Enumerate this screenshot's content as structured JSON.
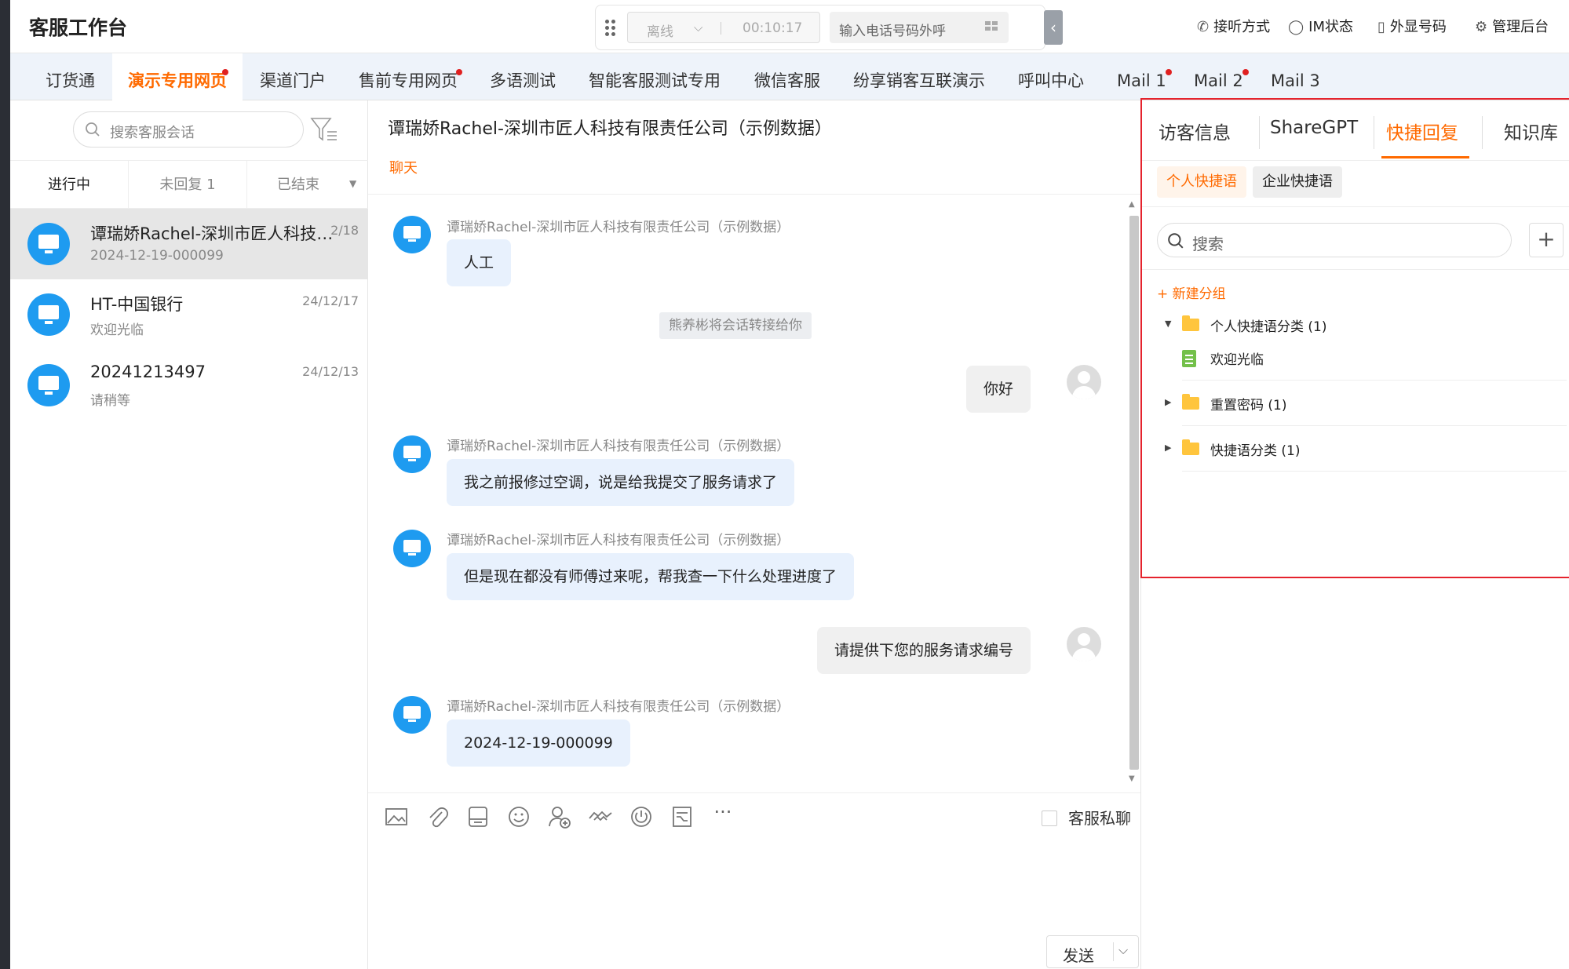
{
  "header": {
    "title": "客服工作台",
    "status": "离线",
    "timer": "00:10:17",
    "dial_placeholder": "输入电话号码外呼",
    "items": [
      {
        "icon": "phone-handset-icon",
        "label": "接听方式"
      },
      {
        "icon": "chat-bubble-icon",
        "label": "IM状态"
      },
      {
        "icon": "mobile-icon",
        "label": "外显号码"
      },
      {
        "icon": "gear-icon",
        "label": "管理后台"
      }
    ]
  },
  "tabs": [
    {
      "label": "订货通",
      "dot": false
    },
    {
      "label": "演示专用网页",
      "dot": true,
      "active": true
    },
    {
      "label": "渠道门户",
      "dot": false
    },
    {
      "label": "售前专用网页",
      "dot": true
    },
    {
      "label": "多语测试",
      "dot": false
    },
    {
      "label": "智能客服测试专用",
      "dot": false
    },
    {
      "label": "微信客服",
      "dot": false
    },
    {
      "label": "纷享销客互联演示",
      "dot": false
    },
    {
      "label": "呼叫中心",
      "dot": false
    },
    {
      "label": "Mail 1",
      "dot": true
    },
    {
      "label": "Mail 2",
      "dot": true
    },
    {
      "label": "Mail 3",
      "dot": false
    }
  ],
  "list": {
    "search_placeholder": "搜索客服会话",
    "subtabs": [
      "进行中",
      "未回复 1",
      "已结束"
    ],
    "conversations": [
      {
        "name": "谭瑞娇Rachel-深圳市匠人科技有限责任公司（示例数据）",
        "sub": "2024-12-19-000099",
        "date": "2/18"
      },
      {
        "name": "HT-中国银行",
        "sub": "欢迎光临",
        "date": "24/12/17"
      },
      {
        "name": "20241213497",
        "sub": "请稍等",
        "date": "24/12/13"
      }
    ]
  },
  "chat": {
    "title": "谭瑞娇Rachel-深圳市匠人科技有限责任公司（示例数据）",
    "subtab": "聊天",
    "sender": "谭瑞娇Rachel-深圳市匠人科技有限责任公司（示例数据）",
    "messages": {
      "m1": "人工",
      "sys": "熊养彬将会话转接给你",
      "m2": "你好",
      "m3": "我之前报修过空调，说是给我提交了服务请求了",
      "m4": "但是现在都没有师傅过来呢，帮我查一下什么处理进度了",
      "m5": "请提供下您的服务请求编号",
      "m6": "2024-12-19-000099"
    },
    "toolbar_icons": [
      "image-icon",
      "attachment-icon",
      "inbox-icon",
      "emoji-icon",
      "add-user-icon",
      "handshake-icon",
      "power-icon",
      "form-icon",
      "more-icon"
    ],
    "private_label": "客服私聊",
    "send_label": "发送"
  },
  "right": {
    "tabs": [
      "访客信息",
      "ShareGPT",
      "快捷回复",
      "知识库"
    ],
    "active_tab": "快捷回复",
    "chips": [
      "个人快捷语",
      "企业快捷语"
    ],
    "search_placeholder": "搜索",
    "new_group": "+ 新建分组",
    "groups": [
      {
        "label": "个人快捷语分类 (1)",
        "expanded": true,
        "items": [
          "欢迎光临"
        ]
      },
      {
        "label": "重置密码 (1)",
        "expanded": false
      },
      {
        "label": "快捷语分类 (1)",
        "expanded": false
      }
    ]
  },
  "colors": {
    "accent": "#ff6a00",
    "avatar": "#1e9bf0",
    "highlight": "#e5232d"
  }
}
